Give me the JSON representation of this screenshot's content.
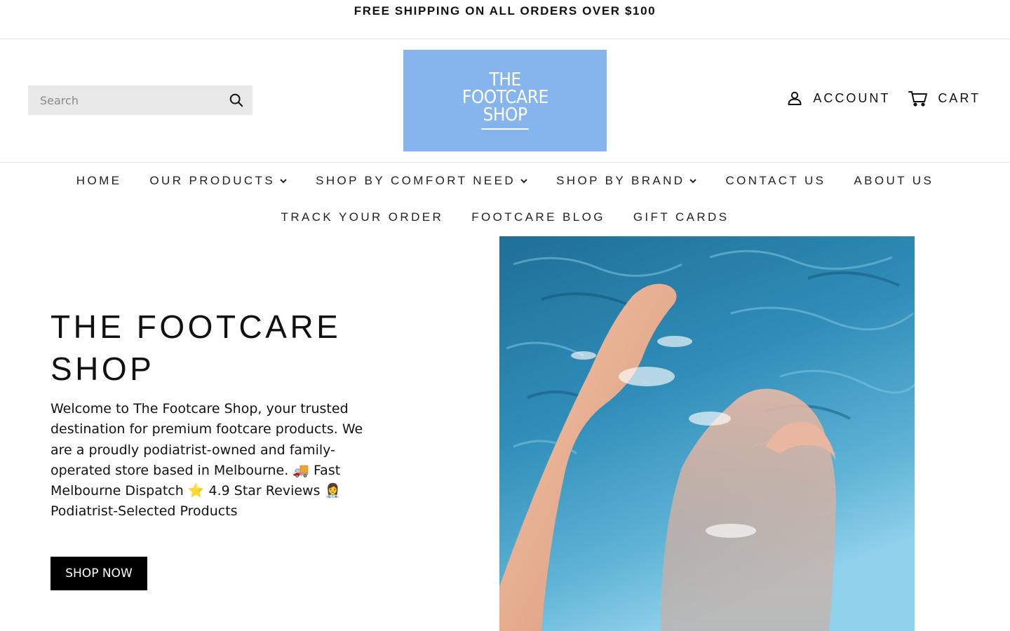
{
  "announcement": {
    "text": "FREE SHIPPING ON ALL ORDERS OVER $100"
  },
  "header": {
    "search": {
      "placeholder": "Search",
      "icon": "search-icon"
    },
    "logo": {
      "lines": [
        "THE",
        "FOOTCARE",
        "SHOP"
      ],
      "background_color": "#86b5ee"
    },
    "account": {
      "label": "ACCOUNT",
      "icon": "user-icon"
    },
    "cart": {
      "label": "CART",
      "icon": "cart-icon"
    }
  },
  "nav": {
    "row1": [
      {
        "label": "HOME",
        "has_dropdown": false
      },
      {
        "label": "OUR PRODUCTS",
        "has_dropdown": true
      },
      {
        "label": "SHOP BY COMFORT NEED",
        "has_dropdown": true
      },
      {
        "label": "SHOP BY BRAND",
        "has_dropdown": true
      },
      {
        "label": "CONTACT US",
        "has_dropdown": false
      },
      {
        "label": "ABOUT US",
        "has_dropdown": false
      }
    ],
    "row2": [
      {
        "label": "TRACK YOUR ORDER",
        "has_dropdown": false
      },
      {
        "label": "FOOTCARE BLOG",
        "has_dropdown": false
      },
      {
        "label": "GIFT CARDS",
        "has_dropdown": false
      }
    ]
  },
  "hero": {
    "title": "THE FOOTCARE SHOP",
    "description": "Welcome to The Footcare Shop, your trusted destination for premium footcare products. We are a proudly podiatrist-owned and family-operated store based in Melbourne. 🚚 Fast Melbourne Dispatch ⭐ 4.9 Star Reviews 👩‍⚕️ Podiatrist-Selected Products",
    "button_label": "SHOP NOW",
    "image": "feet-in-pool-image"
  },
  "colors": {
    "logo_bg": "#86b5ee",
    "button_bg": "#000000",
    "search_bg": "#e8e8e8",
    "pool_blue": "#2a87b0"
  }
}
